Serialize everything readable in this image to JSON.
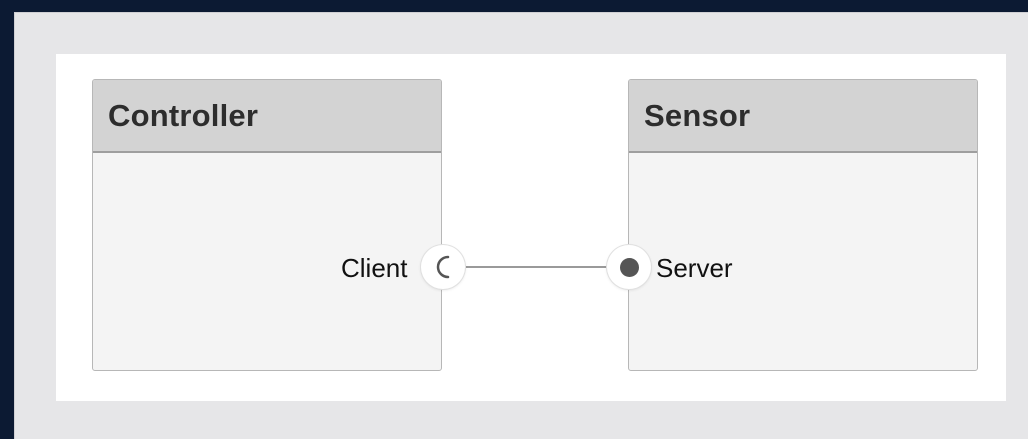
{
  "components": {
    "controller": {
      "title": "Controller"
    },
    "sensor": {
      "title": "Sensor"
    }
  },
  "ports": {
    "client": {
      "label": "Client",
      "icon": "client-port-icon"
    },
    "server": {
      "label": "Server",
      "icon": "server-port-icon"
    }
  },
  "colors": {
    "background_outer": "#0c1a33",
    "frame": "#e6e6e8",
    "canvas": "#ffffff",
    "component_body": "#f4f4f4",
    "component_header": "#d3d3d3",
    "connector": "#9a9a9a",
    "server_dot": "#555555"
  }
}
